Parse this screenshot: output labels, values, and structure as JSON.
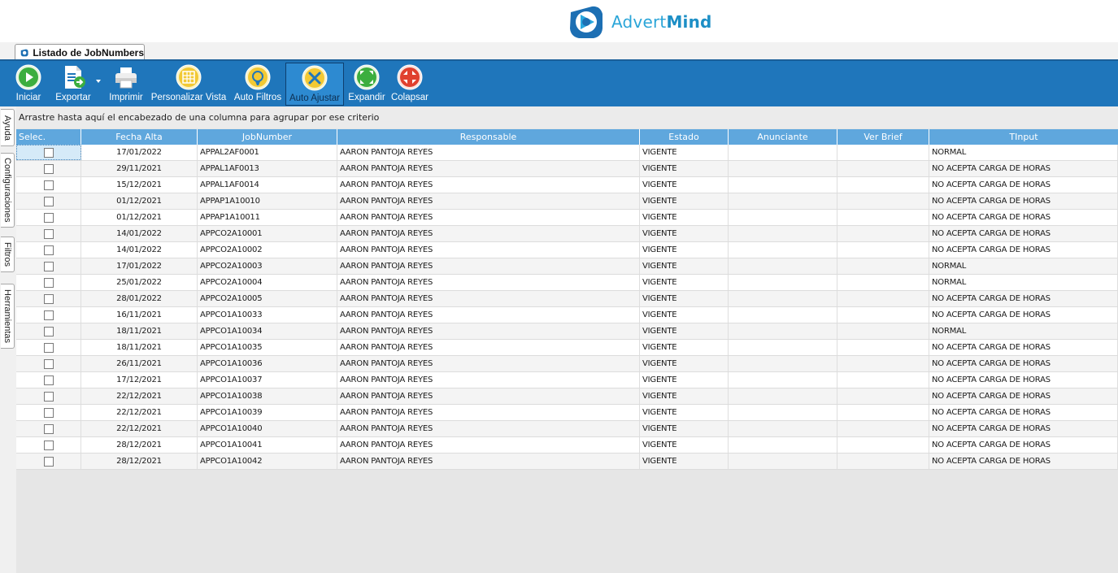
{
  "app": {
    "brand_regular": "Advert",
    "brand_bold": "Mind"
  },
  "doc_tab": {
    "label": "Listado de JobNumbers"
  },
  "toolbar": {
    "buttons": [
      {
        "id": "iniciar",
        "label": "Iniciar",
        "icon": "play-icon"
      },
      {
        "id": "exportar",
        "label": "Exportar",
        "icon": "export-icon"
      },
      {
        "id": "imprimir",
        "label": "Imprimir",
        "icon": "printer-icon"
      },
      {
        "id": "personalizar",
        "label": "Personalizar Vista",
        "icon": "grid-view-icon"
      },
      {
        "id": "autofiltros",
        "label": "Auto Filtros",
        "icon": "filter-icon"
      },
      {
        "id": "autoajustar",
        "label": "Auto Ajustar",
        "icon": "tools-icon",
        "active": true
      },
      {
        "id": "expandir",
        "label": "Expandir",
        "icon": "expand-icon"
      },
      {
        "id": "colapsar",
        "label": "Colapsar",
        "icon": "collapse-icon"
      }
    ]
  },
  "side_tabs": [
    "Ayuda",
    "Configuraciones",
    "Filtros",
    "Herramientas"
  ],
  "group_panel": {
    "text": "Arrastre hasta aquí el encabezado de una columna para agrupar por ese criterio"
  },
  "grid": {
    "columns": [
      "Selec.",
      "Fecha Alta",
      "JobNumber",
      "Responsable",
      "Estado",
      "Anunciante",
      "Ver Brief",
      "TInput"
    ],
    "rows": [
      {
        "fecha": "17/01/2022",
        "job": "APPAL2AF0001",
        "resp": "AARON PANTOJA REYES",
        "estado": "VIGENTE",
        "anunciante": "",
        "brief": "",
        "tinput": "NORMAL"
      },
      {
        "fecha": "29/11/2021",
        "job": "APPAL1AF0013",
        "resp": "AARON PANTOJA REYES",
        "estado": "VIGENTE",
        "anunciante": "",
        "brief": "",
        "tinput": "NO ACEPTA CARGA DE HORAS"
      },
      {
        "fecha": "15/12/2021",
        "job": "APPAL1AF0014",
        "resp": "AARON PANTOJA REYES",
        "estado": "VIGENTE",
        "anunciante": "",
        "brief": "",
        "tinput": "NO ACEPTA CARGA DE HORAS"
      },
      {
        "fecha": "01/12/2021",
        "job": "APPAP1A10010",
        "resp": "AARON PANTOJA REYES",
        "estado": "VIGENTE",
        "anunciante": "",
        "brief": "",
        "tinput": "NO ACEPTA CARGA DE HORAS"
      },
      {
        "fecha": "01/12/2021",
        "job": "APPAP1A10011",
        "resp": "AARON PANTOJA REYES",
        "estado": "VIGENTE",
        "anunciante": "",
        "brief": "",
        "tinput": "NO ACEPTA CARGA DE HORAS"
      },
      {
        "fecha": "14/01/2022",
        "job": "APPCO2A10001",
        "resp": "AARON PANTOJA REYES",
        "estado": "VIGENTE",
        "anunciante": "",
        "brief": "",
        "tinput": "NO ACEPTA CARGA DE HORAS"
      },
      {
        "fecha": "14/01/2022",
        "job": "APPCO2A10002",
        "resp": "AARON PANTOJA REYES",
        "estado": "VIGENTE",
        "anunciante": "",
        "brief": "",
        "tinput": "NO ACEPTA CARGA DE HORAS"
      },
      {
        "fecha": "17/01/2022",
        "job": "APPCO2A10003",
        "resp": "AARON PANTOJA REYES",
        "estado": "VIGENTE",
        "anunciante": "",
        "brief": "",
        "tinput": "NORMAL"
      },
      {
        "fecha": "25/01/2022",
        "job": "APPCO2A10004",
        "resp": "AARON PANTOJA REYES",
        "estado": "VIGENTE",
        "anunciante": "",
        "brief": "",
        "tinput": "NORMAL"
      },
      {
        "fecha": "28/01/2022",
        "job": "APPCO2A10005",
        "resp": "AARON PANTOJA REYES",
        "estado": "VIGENTE",
        "anunciante": "",
        "brief": "",
        "tinput": "NO ACEPTA CARGA DE HORAS"
      },
      {
        "fecha": "16/11/2021",
        "job": "APPCO1A10033",
        "resp": "AARON PANTOJA REYES",
        "estado": "VIGENTE",
        "anunciante": "",
        "brief": "",
        "tinput": "NO ACEPTA CARGA DE HORAS"
      },
      {
        "fecha": "18/11/2021",
        "job": "APPCO1A10034",
        "resp": "AARON PANTOJA REYES",
        "estado": "VIGENTE",
        "anunciante": "",
        "brief": "",
        "tinput": "NORMAL"
      },
      {
        "fecha": "18/11/2021",
        "job": "APPCO1A10035",
        "resp": "AARON PANTOJA REYES",
        "estado": "VIGENTE",
        "anunciante": "",
        "brief": "",
        "tinput": "NO ACEPTA CARGA DE HORAS"
      },
      {
        "fecha": "26/11/2021",
        "job": "APPCO1A10036",
        "resp": "AARON PANTOJA REYES",
        "estado": "VIGENTE",
        "anunciante": "",
        "brief": "",
        "tinput": "NO ACEPTA CARGA DE HORAS"
      },
      {
        "fecha": "17/12/2021",
        "job": "APPCO1A10037",
        "resp": "AARON PANTOJA REYES",
        "estado": "VIGENTE",
        "anunciante": "",
        "brief": "",
        "tinput": "NO ACEPTA CARGA DE HORAS"
      },
      {
        "fecha": "22/12/2021",
        "job": "APPCO1A10038",
        "resp": "AARON PANTOJA REYES",
        "estado": "VIGENTE",
        "anunciante": "",
        "brief": "",
        "tinput": "NO ACEPTA CARGA DE HORAS"
      },
      {
        "fecha": "22/12/2021",
        "job": "APPCO1A10039",
        "resp": "AARON PANTOJA REYES",
        "estado": "VIGENTE",
        "anunciante": "",
        "brief": "",
        "tinput": "NO ACEPTA CARGA DE HORAS"
      },
      {
        "fecha": "22/12/2021",
        "job": "APPCO1A10040",
        "resp": "AARON PANTOJA REYES",
        "estado": "VIGENTE",
        "anunciante": "",
        "brief": "",
        "tinput": "NO ACEPTA CARGA DE HORAS"
      },
      {
        "fecha": "28/12/2021",
        "job": "APPCO1A10041",
        "resp": "AARON PANTOJA REYES",
        "estado": "VIGENTE",
        "anunciante": "",
        "brief": "",
        "tinput": "NO ACEPTA CARGA DE HORAS"
      },
      {
        "fecha": "28/12/2021",
        "job": "APPCO1A10042",
        "resp": "AARON PANTOJA REYES",
        "estado": "VIGENTE",
        "anunciante": "",
        "brief": "",
        "tinput": "NO ACEPTA CARGA DE HORAS"
      }
    ]
  },
  "colors": {
    "toolbar_bg": "#1f76bb",
    "grid_header_bg": "#5fa7dd",
    "brand": "#2aa5d8"
  }
}
